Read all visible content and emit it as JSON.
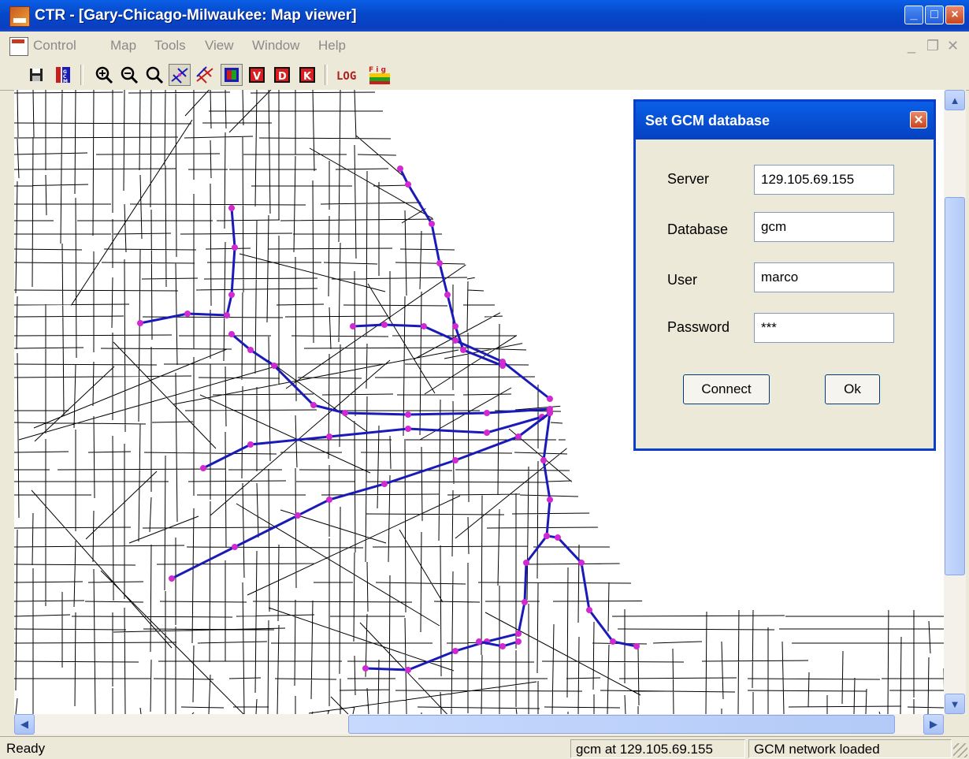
{
  "window": {
    "title": "CTR - [Gary-Chicago-Milwaukee: Map viewer]"
  },
  "menu": {
    "items": [
      "Control",
      "Map",
      "Tools",
      "View",
      "Window",
      "Help"
    ]
  },
  "toolbar": {
    "log_label": "LOG",
    "fig_label": "F i g",
    "v_label": "V",
    "d_label": "D",
    "k_label": "K"
  },
  "dialog": {
    "title": "Set GCM database",
    "server_label": "Server",
    "server_value": "129.105.69.155",
    "database_label": "Database",
    "database_value": "gcm",
    "user_label": "User",
    "user_value": "marco",
    "password_label": "Password",
    "password_value": "***",
    "connect_label": "Connect",
    "ok_label": "Ok"
  },
  "status": {
    "ready": "Ready",
    "connection": "gcm at 129.105.69.155",
    "network": "GCM network loaded"
  },
  "colors": {
    "route": "#1a1ab8",
    "node": "#d02ad0",
    "roads": "#000000",
    "accent": "#0a3fc8"
  }
}
